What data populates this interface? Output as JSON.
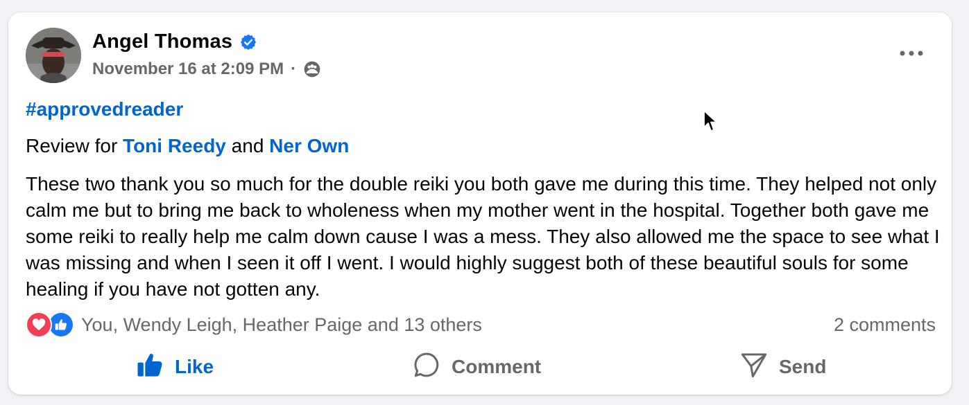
{
  "post": {
    "author": "Angel Thomas",
    "timestamp": "November 16 at 2:09 PM",
    "separator": "·",
    "hashtag": "#approvedreader",
    "review_prefix": "Review for ",
    "mention1": "Toni Reedy",
    "review_and": " and ",
    "mention2": "Ner Own",
    "body": "These two thank you so much for the double reiki you both gave me during this time. They helped not only calm me but to bring me back to wholeness when my mother went in the hospital. Together both gave me some reiki to really help me calm down cause I was a mess. They also allowed me the space to see what I was missing and when I seen it off I went. I would highly suggest both of these beautiful souls for some healing if you have not gotten any."
  },
  "reactions": {
    "summary": "You, Wendy Leigh, Heather Paige and 13 others",
    "comments": "2 comments",
    "icons": [
      "love-icon",
      "like-icon"
    ]
  },
  "actions": {
    "like": "Like",
    "comment": "Comment",
    "send": "Send"
  },
  "colors": {
    "link_blue": "#0064d1",
    "secondary_text": "#65676b",
    "love_red": "#f33e58",
    "like_blue": "#1877f2"
  }
}
